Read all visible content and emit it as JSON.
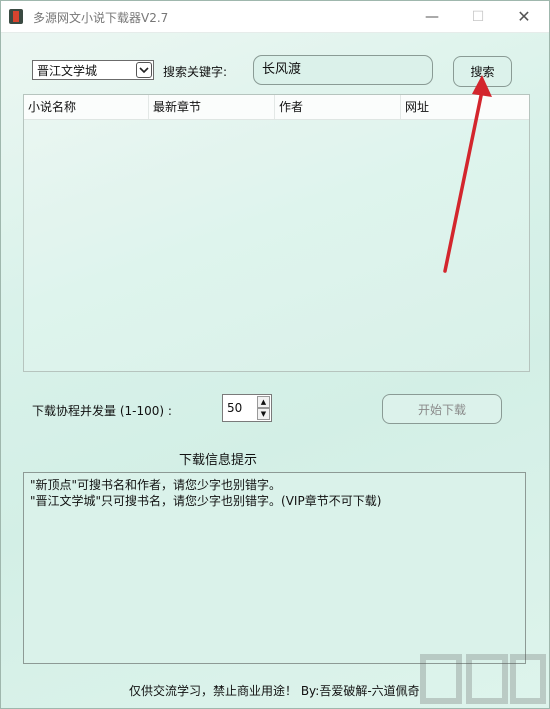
{
  "window": {
    "title": "多源网文小说下载器V2.7",
    "controls": {
      "minimize": "—",
      "maximize": "☐",
      "close": "✕"
    }
  },
  "search": {
    "source_selected": "晋江文学城",
    "keyword_label": "搜索关键字:",
    "keyword_value": "长风渡",
    "button": "搜索"
  },
  "results_table": {
    "columns": [
      "小说名称",
      "最新章节",
      "作者",
      "网址"
    ],
    "rows": []
  },
  "download": {
    "threads_label": "下载协程并发量 (1-100) :",
    "threads_value": "50",
    "start_button": "开始下载"
  },
  "info": {
    "title": "下载信息提示",
    "text": "\"新顶点\"可搜书名和作者，请您少字也别错字。\n\"晋江文学城\"只可搜书名，请您少字也别错字。(VIP章节不可下载)"
  },
  "footer": {
    "text": "仅供交流学习，禁止商业用途！ By:吾爱破解-六道佩奇"
  },
  "colors": {
    "window_bg": "#d9f2ea",
    "annotation_arrow": "#d3262d"
  }
}
